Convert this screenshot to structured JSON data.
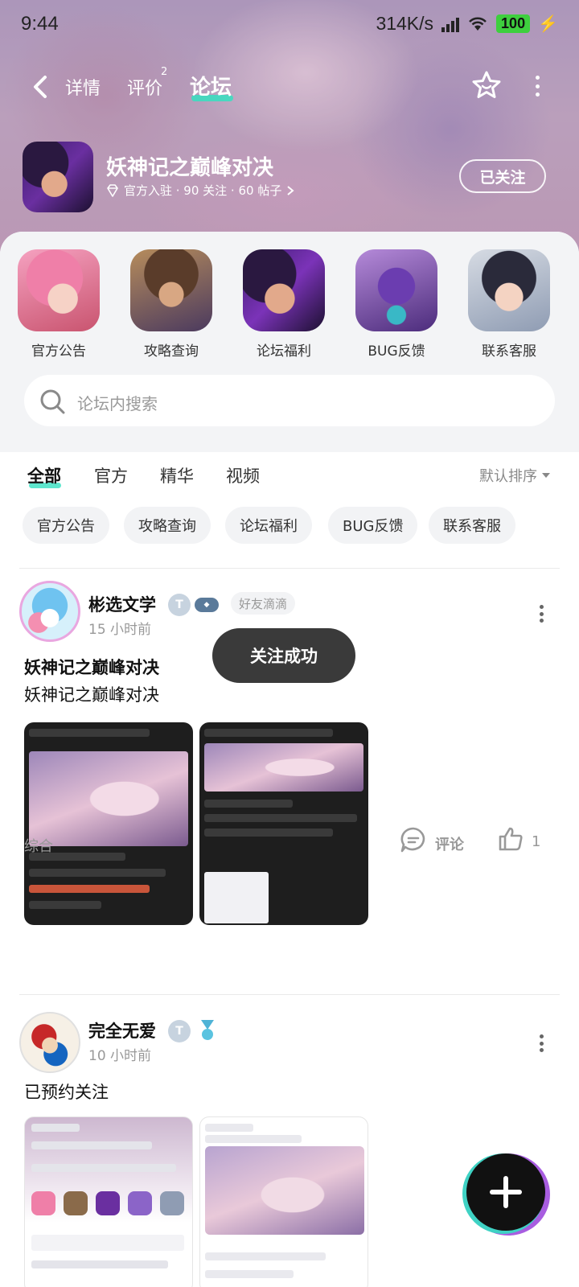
{
  "status_bar": {
    "time": "9:44",
    "network_speed": "314K/s",
    "battery": "100"
  },
  "nav": {
    "tabs": [
      {
        "label": "详情",
        "badge": ""
      },
      {
        "label": "评价",
        "badge": "2"
      },
      {
        "label": "论坛",
        "badge": ""
      }
    ],
    "active_tab": "论坛"
  },
  "game": {
    "title": "妖神记之巅峰对决",
    "meta": "官方入驻 · 90 关注 · 60 帖子",
    "follow_label": "已关注"
  },
  "shortcuts": [
    {
      "label": "官方公告"
    },
    {
      "label": "攻略查询"
    },
    {
      "label": "论坛福利"
    },
    {
      "label": "BUG反馈"
    },
    {
      "label": "联系客服"
    }
  ],
  "search": {
    "placeholder": "论坛内搜索"
  },
  "filter_tabs": [
    {
      "label": "全部"
    },
    {
      "label": "官方"
    },
    {
      "label": "精华"
    },
    {
      "label": "视频"
    }
  ],
  "sort": {
    "label": "默认排序"
  },
  "chips": [
    {
      "label": "官方公告"
    },
    {
      "label": "攻略查询"
    },
    {
      "label": "论坛福利"
    },
    {
      "label": "BUG反馈"
    },
    {
      "label": "联系客服"
    }
  ],
  "posts": [
    {
      "username": "彬选文学",
      "friend_tag": "好友滴滴",
      "time": "15 小时前",
      "title": "妖神记之巅峰对决",
      "body": "妖神记之巅峰对决",
      "category": "综合",
      "comment_label": "评论",
      "likes": "1"
    },
    {
      "username": "完全无爱",
      "time": "10 小时前",
      "body": "已预约关注"
    }
  ],
  "toast": {
    "text": "关注成功"
  },
  "colors": {
    "accent": "#35e0c0",
    "toast_bg": "#3a3a3a"
  }
}
